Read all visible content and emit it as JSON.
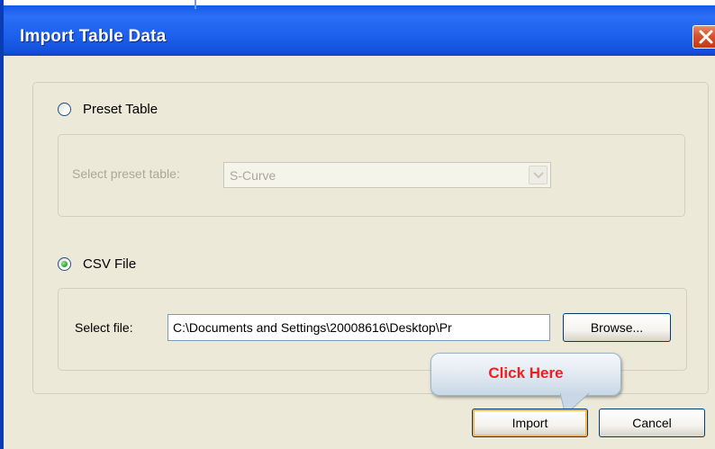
{
  "window": {
    "title": "Import Table Data",
    "close_icon": "close-icon"
  },
  "preset": {
    "radio_label": "Preset Table",
    "selected": false,
    "field_label": "Select preset table:",
    "select_value": "S-Curve",
    "disabled": true
  },
  "csv": {
    "radio_label": "CSV File",
    "selected": true,
    "field_label": "Select file:",
    "file_path": "C:\\Documents and Settings\\20008616\\Desktop\\Pr",
    "browse_label": "Browse..."
  },
  "callout": {
    "text": "Click Here"
  },
  "buttons": {
    "import_label": "Import",
    "cancel_label": "Cancel"
  },
  "colors": {
    "titlebar": "#1559ea",
    "dialog_bg": "#ece9d8",
    "callout_text": "#ff1a1a",
    "close_button": "#d6532d",
    "radio_selected_dot": "#3fb53f"
  }
}
